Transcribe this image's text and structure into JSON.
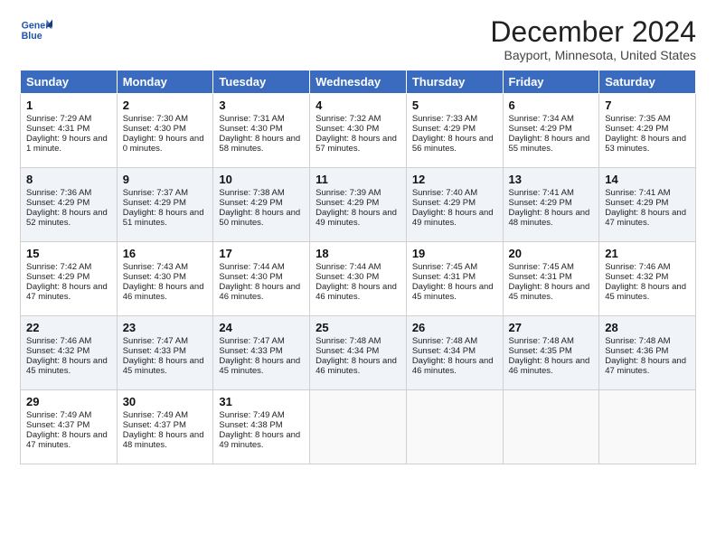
{
  "logo": {
    "line1": "General",
    "line2": "Blue"
  },
  "title": "December 2024",
  "location": "Bayport, Minnesota, United States",
  "days_of_week": [
    "Sunday",
    "Monday",
    "Tuesday",
    "Wednesday",
    "Thursday",
    "Friday",
    "Saturday"
  ],
  "weeks": [
    [
      {
        "day": 1,
        "sunrise": "7:29 AM",
        "sunset": "4:31 PM",
        "daylight": "9 hours and 1 minute."
      },
      {
        "day": 2,
        "sunrise": "7:30 AM",
        "sunset": "4:30 PM",
        "daylight": "9 hours and 0 minutes."
      },
      {
        "day": 3,
        "sunrise": "7:31 AM",
        "sunset": "4:30 PM",
        "daylight": "8 hours and 58 minutes."
      },
      {
        "day": 4,
        "sunrise": "7:32 AM",
        "sunset": "4:30 PM",
        "daylight": "8 hours and 57 minutes."
      },
      {
        "day": 5,
        "sunrise": "7:33 AM",
        "sunset": "4:29 PM",
        "daylight": "8 hours and 56 minutes."
      },
      {
        "day": 6,
        "sunrise": "7:34 AM",
        "sunset": "4:29 PM",
        "daylight": "8 hours and 55 minutes."
      },
      {
        "day": 7,
        "sunrise": "7:35 AM",
        "sunset": "4:29 PM",
        "daylight": "8 hours and 53 minutes."
      }
    ],
    [
      {
        "day": 8,
        "sunrise": "7:36 AM",
        "sunset": "4:29 PM",
        "daylight": "8 hours and 52 minutes."
      },
      {
        "day": 9,
        "sunrise": "7:37 AM",
        "sunset": "4:29 PM",
        "daylight": "8 hours and 51 minutes."
      },
      {
        "day": 10,
        "sunrise": "7:38 AM",
        "sunset": "4:29 PM",
        "daylight": "8 hours and 50 minutes."
      },
      {
        "day": 11,
        "sunrise": "7:39 AM",
        "sunset": "4:29 PM",
        "daylight": "8 hours and 49 minutes."
      },
      {
        "day": 12,
        "sunrise": "7:40 AM",
        "sunset": "4:29 PM",
        "daylight": "8 hours and 49 minutes."
      },
      {
        "day": 13,
        "sunrise": "7:41 AM",
        "sunset": "4:29 PM",
        "daylight": "8 hours and 48 minutes."
      },
      {
        "day": 14,
        "sunrise": "7:41 AM",
        "sunset": "4:29 PM",
        "daylight": "8 hours and 47 minutes."
      }
    ],
    [
      {
        "day": 15,
        "sunrise": "7:42 AM",
        "sunset": "4:29 PM",
        "daylight": "8 hours and 47 minutes."
      },
      {
        "day": 16,
        "sunrise": "7:43 AM",
        "sunset": "4:30 PM",
        "daylight": "8 hours and 46 minutes."
      },
      {
        "day": 17,
        "sunrise": "7:44 AM",
        "sunset": "4:30 PM",
        "daylight": "8 hours and 46 minutes."
      },
      {
        "day": 18,
        "sunrise": "7:44 AM",
        "sunset": "4:30 PM",
        "daylight": "8 hours and 46 minutes."
      },
      {
        "day": 19,
        "sunrise": "7:45 AM",
        "sunset": "4:31 PM",
        "daylight": "8 hours and 45 minutes."
      },
      {
        "day": 20,
        "sunrise": "7:45 AM",
        "sunset": "4:31 PM",
        "daylight": "8 hours and 45 minutes."
      },
      {
        "day": 21,
        "sunrise": "7:46 AM",
        "sunset": "4:32 PM",
        "daylight": "8 hours and 45 minutes."
      }
    ],
    [
      {
        "day": 22,
        "sunrise": "7:46 AM",
        "sunset": "4:32 PM",
        "daylight": "8 hours and 45 minutes."
      },
      {
        "day": 23,
        "sunrise": "7:47 AM",
        "sunset": "4:33 PM",
        "daylight": "8 hours and 45 minutes."
      },
      {
        "day": 24,
        "sunrise": "7:47 AM",
        "sunset": "4:33 PM",
        "daylight": "8 hours and 45 minutes."
      },
      {
        "day": 25,
        "sunrise": "7:48 AM",
        "sunset": "4:34 PM",
        "daylight": "8 hours and 46 minutes."
      },
      {
        "day": 26,
        "sunrise": "7:48 AM",
        "sunset": "4:34 PM",
        "daylight": "8 hours and 46 minutes."
      },
      {
        "day": 27,
        "sunrise": "7:48 AM",
        "sunset": "4:35 PM",
        "daylight": "8 hours and 46 minutes."
      },
      {
        "day": 28,
        "sunrise": "7:48 AM",
        "sunset": "4:36 PM",
        "daylight": "8 hours and 47 minutes."
      }
    ],
    [
      {
        "day": 29,
        "sunrise": "7:49 AM",
        "sunset": "4:37 PM",
        "daylight": "8 hours and 47 minutes."
      },
      {
        "day": 30,
        "sunrise": "7:49 AM",
        "sunset": "4:37 PM",
        "daylight": "8 hours and 48 minutes."
      },
      {
        "day": 31,
        "sunrise": "7:49 AM",
        "sunset": "4:38 PM",
        "daylight": "8 hours and 49 minutes."
      },
      null,
      null,
      null,
      null
    ]
  ]
}
